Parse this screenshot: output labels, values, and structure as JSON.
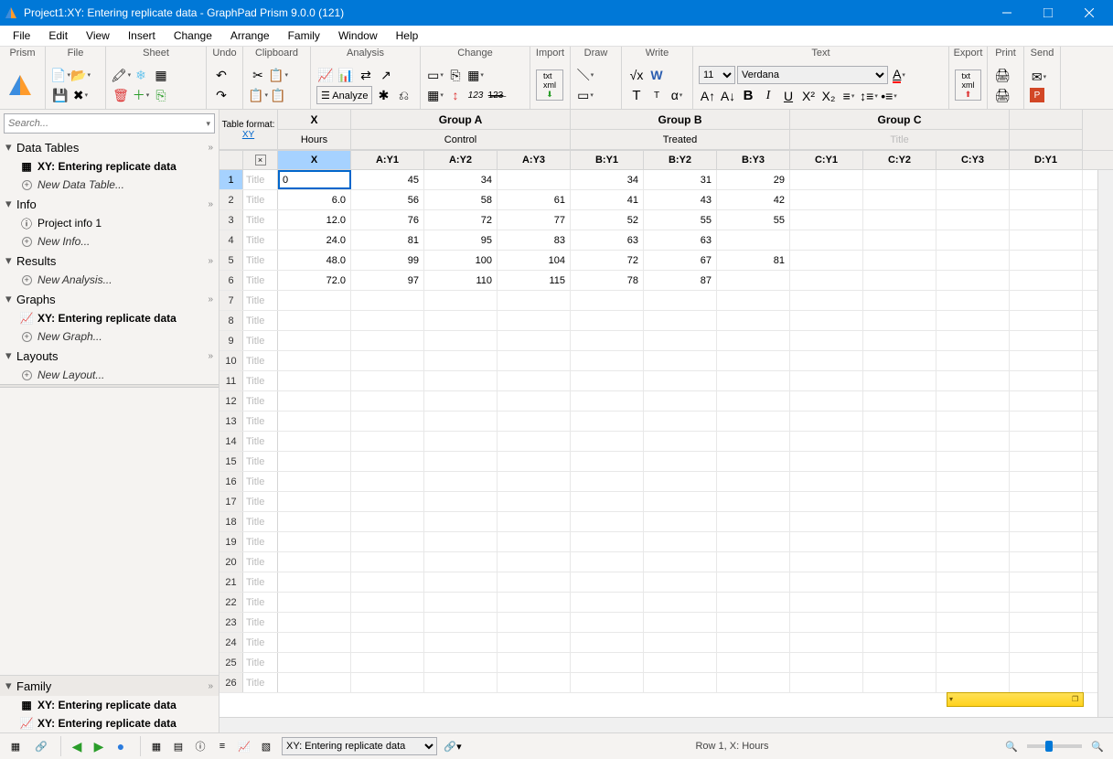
{
  "window": {
    "title": "Project1:XY: Entering replicate data - GraphPad Prism 9.0.0 (121)"
  },
  "menu": [
    "File",
    "Edit",
    "View",
    "Insert",
    "Change",
    "Arrange",
    "Family",
    "Window",
    "Help"
  ],
  "ribbon_groups": [
    "Prism",
    "File",
    "Sheet",
    "Undo",
    "Clipboard",
    "Analysis",
    "Change",
    "Import",
    "Draw",
    "Write",
    "Text",
    "Export",
    "Print",
    "Send"
  ],
  "ribbon": {
    "analyze_label": "Analyze",
    "font_size": "11",
    "font_name": "Verdana"
  },
  "sidebar": {
    "search_placeholder": "Search...",
    "sections": {
      "data_tables": {
        "label": "Data Tables",
        "items": [
          {
            "label": "XY: Entering replicate data",
            "bold": true
          }
        ],
        "new": "New Data Table..."
      },
      "info": {
        "label": "Info",
        "items": [
          {
            "label": "Project info 1"
          }
        ],
        "new": "New Info..."
      },
      "results": {
        "label": "Results",
        "new": "New Analysis..."
      },
      "graphs": {
        "label": "Graphs",
        "items": [
          {
            "label": "XY: Entering replicate data",
            "bold": true
          }
        ],
        "new": "New Graph..."
      },
      "layouts": {
        "label": "Layouts",
        "new": "New Layout..."
      }
    },
    "family": {
      "label": "Family",
      "items": [
        "XY: Entering replicate data",
        "XY: Entering replicate data"
      ]
    }
  },
  "table": {
    "format_label": "Table format:",
    "format_value": "XY",
    "groups": [
      {
        "name": "X",
        "title": "Hours",
        "subs": [
          "X"
        ]
      },
      {
        "name": "Group A",
        "title": "Control",
        "subs": [
          "A:Y1",
          "A:Y2",
          "A:Y3"
        ]
      },
      {
        "name": "Group B",
        "title": "Treated",
        "subs": [
          "B:Y1",
          "B:Y2",
          "B:Y3"
        ]
      },
      {
        "name": "Group C",
        "title": "Title",
        "title_gray": true,
        "subs": [
          "C:Y1",
          "C:Y2",
          "C:Y3"
        ]
      },
      {
        "name": "",
        "title": "",
        "subs": [
          "D:Y1"
        ]
      }
    ],
    "rows": [
      {
        "n": 1,
        "title": "Title",
        "x": "0",
        "a": [
          "45",
          "34",
          ""
        ],
        "b": [
          "34",
          "31",
          "29"
        ],
        "c": [
          "",
          "",
          ""
        ],
        "d": [
          ""
        ]
      },
      {
        "n": 2,
        "title": "Title",
        "x": "6.0",
        "a": [
          "56",
          "58",
          "61"
        ],
        "b": [
          "41",
          "43",
          "42"
        ],
        "c": [
          "",
          "",
          ""
        ],
        "d": [
          ""
        ]
      },
      {
        "n": 3,
        "title": "Title",
        "x": "12.0",
        "a": [
          "76",
          "72",
          "77"
        ],
        "b": [
          "52",
          "55",
          "55"
        ],
        "c": [
          "",
          "",
          ""
        ],
        "d": [
          ""
        ]
      },
      {
        "n": 4,
        "title": "Title",
        "x": "24.0",
        "a": [
          "81",
          "95",
          "83"
        ],
        "b": [
          "63",
          "63",
          ""
        ],
        "c": [
          "",
          "",
          ""
        ],
        "d": [
          ""
        ]
      },
      {
        "n": 5,
        "title": "Title",
        "x": "48.0",
        "a": [
          "99",
          "100",
          "104"
        ],
        "b": [
          "72",
          "67",
          "81"
        ],
        "c": [
          "",
          "",
          ""
        ],
        "d": [
          ""
        ]
      },
      {
        "n": 6,
        "title": "Title",
        "x": "72.0",
        "a": [
          "97",
          "110",
          "115"
        ],
        "b": [
          "78",
          "87",
          ""
        ],
        "c": [
          "",
          "",
          ""
        ],
        "d": [
          ""
        ]
      },
      {
        "n": 7,
        "title": "Title"
      },
      {
        "n": 8,
        "title": "Title"
      },
      {
        "n": 9,
        "title": "Title"
      },
      {
        "n": 10,
        "title": "Title"
      },
      {
        "n": 11,
        "title": "Title"
      },
      {
        "n": 12,
        "title": "Title"
      },
      {
        "n": 13,
        "title": "Title"
      },
      {
        "n": 14,
        "title": "Title"
      },
      {
        "n": 15,
        "title": "Title"
      },
      {
        "n": 16,
        "title": "Title"
      },
      {
        "n": 17,
        "title": "Title"
      },
      {
        "n": 18,
        "title": "Title"
      },
      {
        "n": 19,
        "title": "Title"
      },
      {
        "n": 20,
        "title": "Title"
      },
      {
        "n": 21,
        "title": "Title"
      },
      {
        "n": 22,
        "title": "Title"
      },
      {
        "n": 23,
        "title": "Title"
      },
      {
        "n": 24,
        "title": "Title"
      },
      {
        "n": 25,
        "title": "Title"
      },
      {
        "n": 26,
        "title": "Title"
      }
    ],
    "editing_cell": {
      "row": 0,
      "col": 0
    }
  },
  "statusbar": {
    "sheet_name": "XY: Entering replicate data",
    "cursor": "Row 1, X: Hours"
  }
}
